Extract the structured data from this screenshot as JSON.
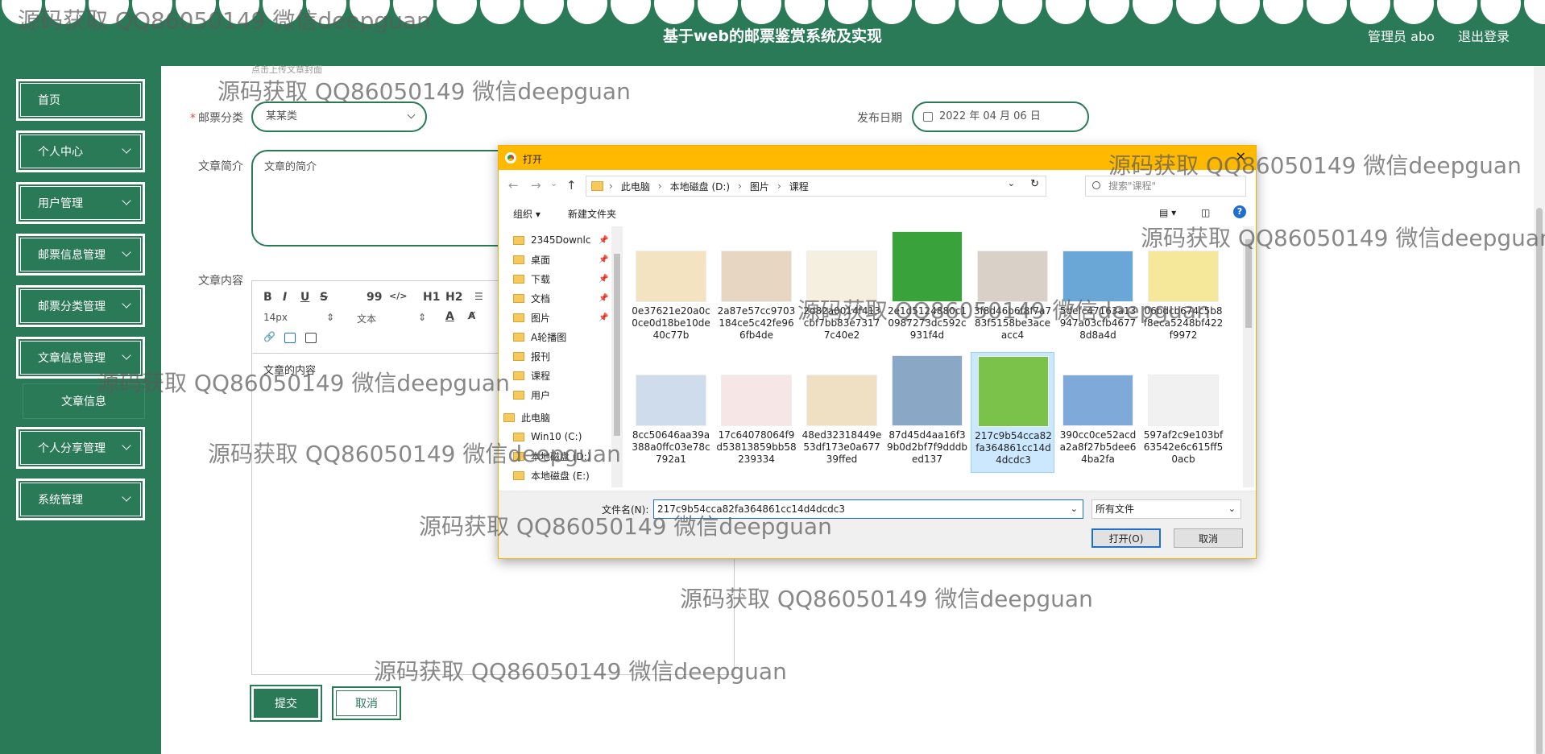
{
  "header": {
    "title": "基于web的邮票鉴赏系统及实现",
    "user": "管理员 abo",
    "logout": "退出登录"
  },
  "sidebar": {
    "items": [
      {
        "label": "首页"
      },
      {
        "label": "个人中心"
      },
      {
        "label": "用户管理"
      },
      {
        "label": "邮票信息管理"
      },
      {
        "label": "邮票分类管理"
      },
      {
        "label": "文章信息管理"
      },
      {
        "label": "个人分享管理"
      },
      {
        "label": "系统管理"
      }
    ],
    "sub_item": "文章信息"
  },
  "form": {
    "cover_hint": "点击上传文章封面",
    "category_label": "邮票分类",
    "category_value": "某某类",
    "date_label": "发布日期",
    "date_value": "2022 年 04 月 06 日",
    "intro_label": "文章简介",
    "intro_value": "文章的简介",
    "content_label": "文章内容",
    "content_value": "文章的内容",
    "toolbar": {
      "bold": "B",
      "italic": "I",
      "underline": "U",
      "strike": "S",
      "quote": "99",
      "code": "</>",
      "h1": "H1",
      "h2": "H2",
      "font_size": "14px",
      "font_family": "文本"
    },
    "submit": "提交",
    "cancel": "取消"
  },
  "dialog": {
    "title": "打开",
    "breadcrumb": [
      "此电脑",
      "本地磁盘 (D:)",
      "图片",
      "课程"
    ],
    "search_placeholder": "搜索\"课程\"",
    "organize": "组织 ▾",
    "new_folder": "新建文件夹",
    "nav": [
      {
        "label": "2345Downlc",
        "pin": true
      },
      {
        "label": "桌面",
        "pin": true
      },
      {
        "label": "下载",
        "pin": true
      },
      {
        "label": "文档",
        "pin": true
      },
      {
        "label": "图片",
        "pin": true
      },
      {
        "label": "A轮播图",
        "pin": false
      },
      {
        "label": "报刊",
        "pin": false
      },
      {
        "label": "课程",
        "pin": false
      },
      {
        "label": "用户",
        "pin": false
      },
      {
        "label": "此电脑",
        "pin": false
      },
      {
        "label": "Win10 (C:)",
        "pin": false
      },
      {
        "label": "本地磁盘 (D:)",
        "pin": false
      },
      {
        "label": "本地磁盘 (E:)",
        "pin": false
      }
    ],
    "files": [
      {
        "name": "0e37621e20a0c0ce0d18be10de40c77b",
        "color": "#f3e3c0",
        "selected": false
      },
      {
        "name": "2a87e57cc9703184ce5c42fe966fb4de",
        "color": "#e7d6c2",
        "selected": false
      },
      {
        "name": "2d82a0014f413cbf7bb83e73177c40e2",
        "color": "#f5efe0",
        "selected": false
      },
      {
        "name": "2e1d5124880c10987273dc592c931f4d",
        "color": "#3aa23a",
        "selected": false
      },
      {
        "name": "3f8d46b6f8f7a783f5158be3aceacc4",
        "color": "#d9d1c7",
        "selected": false
      },
      {
        "name": "5defc47163a13947a03cfb46778d8a4d",
        "color": "#6aa6d6",
        "selected": false
      },
      {
        "name": "06bdcb674c5b8f8eca5248bf422f9972",
        "color": "#f6e89a",
        "selected": false
      },
      {
        "name": "8cc50646aa39a388a0ffc03e78c792a1",
        "color": "#cfdcec",
        "selected": false
      },
      {
        "name": "17c64078064f9d53813859bb58239334",
        "color": "#f7e6e6",
        "selected": false
      },
      {
        "name": "48ed32318449e53df173e0a67739ffed",
        "color": "#efe0c4",
        "selected": false
      },
      {
        "name": "87d45d4aa16f39b0d2bf7f9dddbed137",
        "color": "#8aa7c6",
        "selected": false
      },
      {
        "name": "217c9b54cca82fa364861cc14d4dcdc3",
        "color": "#7bc24a",
        "selected": true
      },
      {
        "name": "390cc0ce52acda2a8f27b5dee64ba2fa",
        "color": "#7fa9d8",
        "selected": false
      },
      {
        "name": "597af2c9e103bf63542e6c615ff50acb",
        "color": "#f1f1f1",
        "selected": false
      }
    ],
    "filename_label": "文件名(N):",
    "filename_value": "217c9b54cca82fa364861cc14d4dcdc3",
    "filetype": "所有文件",
    "open": "打开(O)",
    "cancel": "取消"
  },
  "watermark": "源码获取 QQ86050149 微信deepguan",
  "colors": {
    "primary": "#2a7a57",
    "dialog_title": "#ffb900",
    "selection": "#cce8ff"
  }
}
